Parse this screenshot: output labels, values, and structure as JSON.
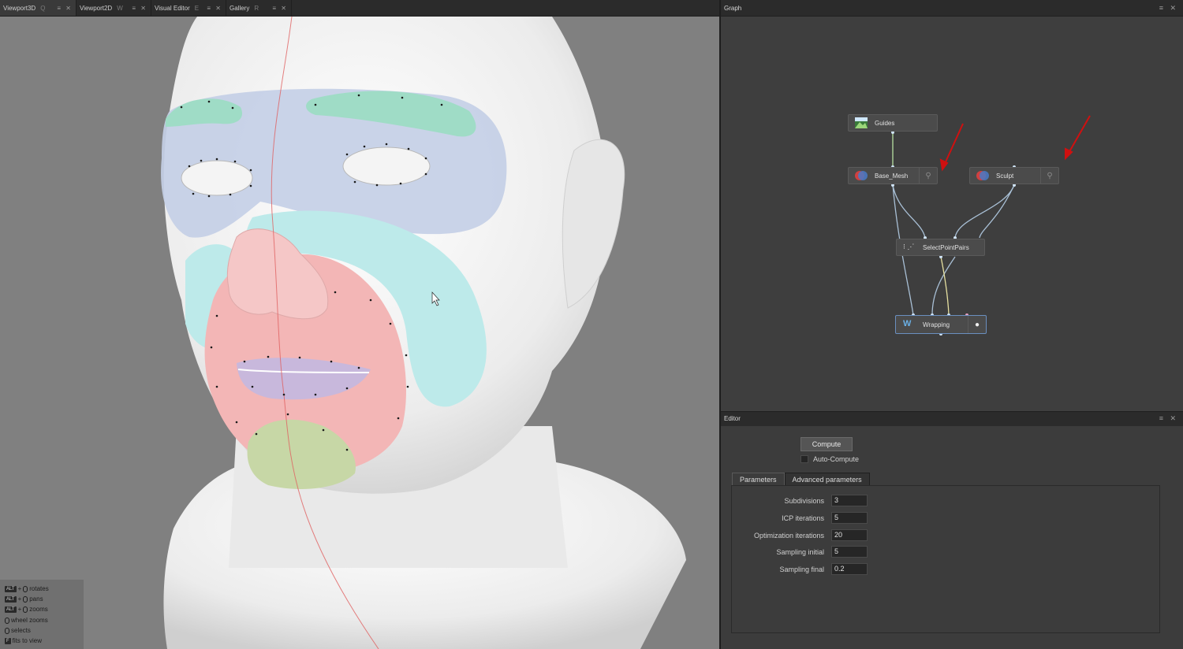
{
  "tabs": [
    {
      "label": "Viewport3D",
      "hotkey": "Q"
    },
    {
      "label": "Viewport2D",
      "hotkey": "W"
    },
    {
      "label": "Visual Editor",
      "hotkey": "E"
    },
    {
      "label": "Gallery",
      "hotkey": "R"
    }
  ],
  "viewport": {
    "hints": [
      {
        "key": "ALT",
        "text": "rotates"
      },
      {
        "key": "ALT",
        "text": "pans"
      },
      {
        "key": "ALT",
        "text": "zooms"
      },
      {
        "key": "",
        "text": "wheel zooms"
      },
      {
        "key": "",
        "text": "selects"
      },
      {
        "key": "F",
        "text": "fits to view"
      }
    ],
    "hint_plus": "+"
  },
  "graph": {
    "title": "Graph",
    "nodes": {
      "guides": "Guides",
      "base_mesh": "Base_Mesh",
      "sculpt": "Sculpt",
      "select_point_pairs": "SelectPointPairs",
      "wrapping": "Wrapping"
    },
    "annotation_color": "#d01010"
  },
  "editor": {
    "title": "Editor",
    "compute_label": "Compute",
    "auto_compute_label": "Auto-Compute",
    "tabs": [
      "Parameters",
      "Advanced parameters"
    ],
    "params": [
      {
        "label": "Subdivisions",
        "value": "3"
      },
      {
        "label": "ICP iterations",
        "value": "5"
      },
      {
        "label": "Optimization iterations",
        "value": "20"
      },
      {
        "label": "Sampling initial",
        "value": "5"
      },
      {
        "label": "Sampling final",
        "value": "0.2"
      }
    ]
  },
  "colors": {
    "skin": "#f2f2f2",
    "brow": "#9fdcc6",
    "eyes_region": "#c4cfe6",
    "cheek": "#bdeaea",
    "mouth_region": "#f3b6b6",
    "lips": "#c8b8dc",
    "chin": "#c7d7a6",
    "midline": "#e06060"
  }
}
